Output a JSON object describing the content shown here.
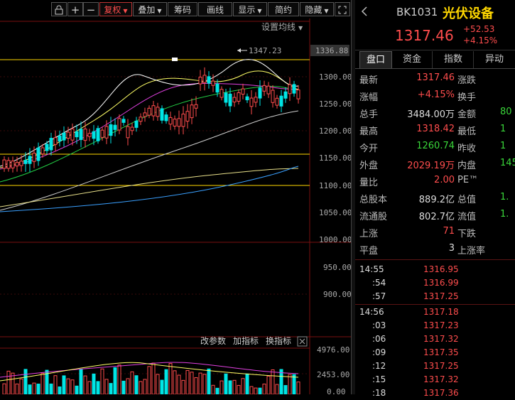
{
  "toolbar": {
    "buttons": [
      {
        "label": "复权",
        "active": true,
        "dropdown": true
      },
      {
        "label": "叠加",
        "active": false,
        "dropdown": true
      },
      {
        "label": "筹码",
        "active": false,
        "dropdown": false
      },
      {
        "label": "画线",
        "active": false,
        "dropdown": false
      },
      {
        "label": "显示",
        "active": false,
        "dropdown": true
      },
      {
        "label": "简约",
        "active": false,
        "dropdown": false
      },
      {
        "label": "隐藏",
        "active": false,
        "dropdown": true
      }
    ]
  },
  "chart": {
    "ma_settings_label": "设置均线",
    "high_label": "1347.23",
    "current_price_tag": "1336.88",
    "price_ticks": [
      "1300.00",
      "1250.00",
      "1200.00",
      "1150.00",
      "1100.00",
      "1050.00",
      "1000.00",
      "950.00",
      "900.00"
    ],
    "indicator_buttons": [
      "改参数",
      "加指标",
      "换指标"
    ],
    "volume_ticks": [
      "4976.00",
      "2453.00",
      "0.00"
    ]
  },
  "quote": {
    "code": "BK1031",
    "name": "光伏设备",
    "price": "1317.46",
    "change": "+52.53",
    "change_pct": "+4.15%"
  },
  "tabs": [
    "盘口",
    "资金",
    "指数",
    "异动"
  ],
  "stats": [
    {
      "l1": "最新",
      "v1": "1317.46",
      "c1": "red",
      "l2": "涨跌",
      "v2": ""
    },
    {
      "l1": "涨幅",
      "v1": "+4.15%",
      "c1": "red",
      "l2": "换手",
      "v2": ""
    },
    {
      "l1": "总手",
      "v1": "3484.00万",
      "c1": "white",
      "l2": "金额",
      "v2": "80"
    },
    {
      "l1": "最高",
      "v1": "1318.42",
      "c1": "red",
      "l2": "最低",
      "v2": "1"
    },
    {
      "l1": "今开",
      "v1": "1260.74",
      "c1": "green",
      "l2": "昨收",
      "v2": "1"
    },
    {
      "l1": "外盘",
      "v1": "2029.19万",
      "c1": "red",
      "l2": "内盘",
      "v2": "145"
    },
    {
      "l1": "量比",
      "v1": "2.00",
      "c1": "red",
      "l2": "PE™",
      "v2": ""
    },
    {
      "l1": "总股本",
      "v1": "889.2亿",
      "c1": "white",
      "l2": "总值",
      "v2": "1."
    },
    {
      "l1": "流通股",
      "v1": "802.7亿",
      "c1": "white",
      "l2": "流值",
      "v2": "1."
    },
    {
      "l1": "上涨",
      "v1": "71",
      "c1": "red",
      "l2": "下跌",
      "v2": ""
    },
    {
      "l1": "平盘",
      "v1": "3",
      "c1": "white",
      "l2": "上涨率",
      "v2": ""
    }
  ],
  "ticks": [
    {
      "time": "14:55",
      "price": "1316.95",
      "major": true
    },
    {
      "time": ":54",
      "price": "1316.99",
      "major": false
    },
    {
      "time": ":57",
      "price": "1317.25",
      "major": false
    },
    {
      "time": "14:56",
      "price": "1317.18",
      "major": true
    },
    {
      "time": ":03",
      "price": "1317.23",
      "major": false
    },
    {
      "time": ":06",
      "price": "1317.32",
      "major": false
    },
    {
      "time": ":09",
      "price": "1317.35",
      "major": false
    },
    {
      "time": ":12",
      "price": "1317.25",
      "major": false
    },
    {
      "time": ":15",
      "price": "1317.32",
      "major": false
    },
    {
      "time": ":18",
      "price": "1317.36",
      "major": false
    }
  ],
  "colors": {
    "up": "#ff4d4d",
    "down": "#00e5e5",
    "accent": "#ffd700"
  }
}
